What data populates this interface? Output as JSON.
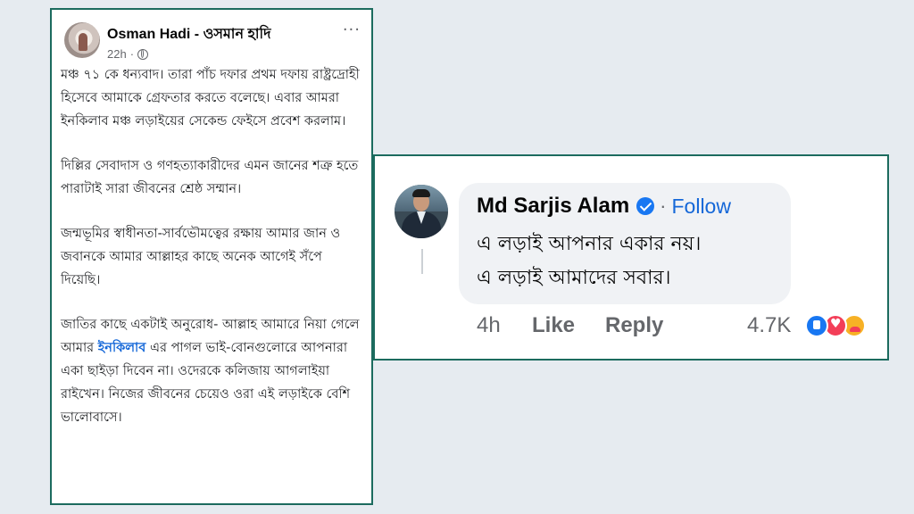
{
  "post": {
    "author": "Osman Hadi - ওসমান হাদি",
    "time": "22h",
    "time_separator": "·",
    "privacy_icon": "globe-icon",
    "more_icon": "more-options-icon",
    "more_label": "···",
    "paragraphs": [
      "মঞ্চ ৭১ কে ধন্যবাদ। তারা পাঁচ দফার প্রথম দফায় রাষ্ট্রদ্রোহী হিসেবে আমাকে গ্রেফতার করতে বলেছে। এবার আমরা ইনকিলাব মঞ্চ লড়াইয়ের সেকেন্ড ফেইসে প্রবেশ করলাম।",
      "দিল্লির সেবাদাস ও গণহত্যাকারীদের এমন জানের শত্রু হতে পারাটাই সারা জীবনের শ্রেষ্ঠ সম্মান।",
      "জন্মভূমির স্বাধীনতা-সার্বভৌমত্বের রক্ষায় আমার জান ও জবানকে আমার আল্লাহর কাছে অনেক আগেই সঁপে দিয়েছি।"
    ],
    "last_paragraph": {
      "before_link": "জাতির কাছে একটাই অনুরোধ- আল্লাহ আমারে নিয়া গেলে আমার ",
      "link_text": "ইনকিলাব",
      "after_link": " এর পাগল ভাই-বোনগুলোরে আপনারা একা ছাইড়া দিবেন না। ওদেরকে কলিজায় আগলাইয়া রাইখেন। নিজের জীবনের চেয়েও ওরা এই লড়াইকে বেশি ভালোবাসে।"
    }
  },
  "comment": {
    "name": "Md Sarjis Alam",
    "verified_icon": "verified-badge-icon",
    "separator": "·",
    "follow_label": "Follow",
    "lines": [
      "এ লড়াই আপনার একার নয়।",
      "এ লড়াই আমাদের সবার।"
    ],
    "time": "4h",
    "like_label": "Like",
    "reply_label": "Reply",
    "reaction_count": "4.7K",
    "reactions": [
      "like-icon",
      "love-icon",
      "care-icon"
    ]
  },
  "colors": {
    "frame_border": "#1c6b5e",
    "link_blue": "#1467d8",
    "verified_blue": "#1877f2",
    "bubble_bg": "#f0f2f5",
    "page_bg": "#e6ebf0"
  }
}
